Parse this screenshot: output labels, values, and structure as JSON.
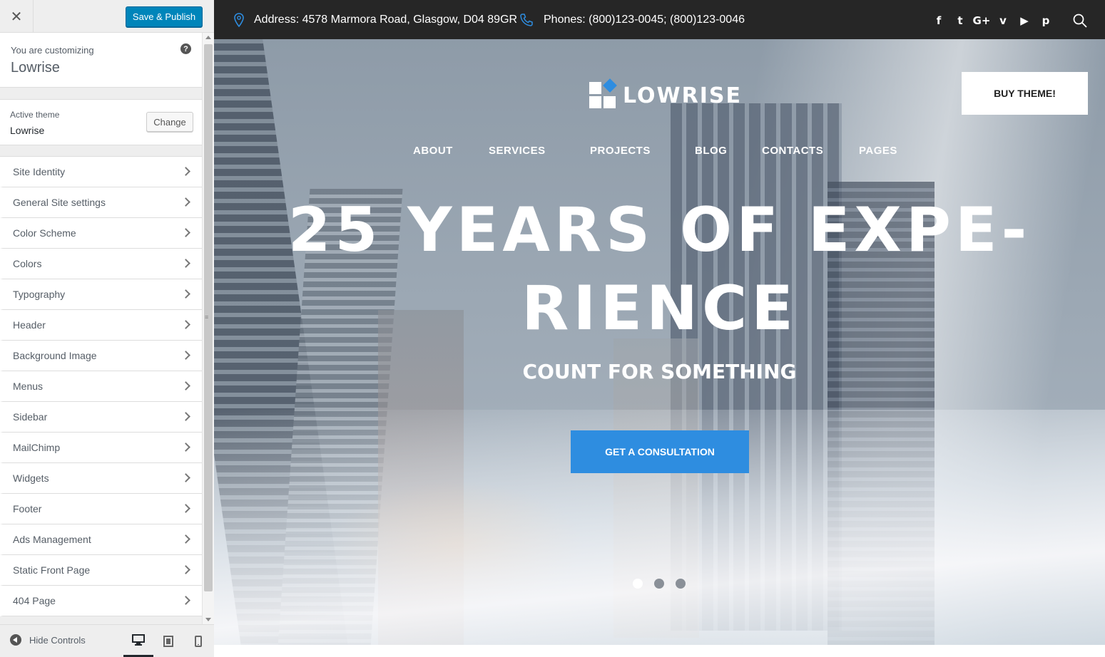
{
  "customizer": {
    "close_label": "✕",
    "publish_label": "Save & Publish",
    "info": {
      "label": "You are customizing",
      "title": "Lowrise",
      "help": "?"
    },
    "theme": {
      "label": "Active theme",
      "name": "Lowrise",
      "change_label": "Change"
    },
    "sections": [
      {
        "label": "Site Identity"
      },
      {
        "label": "General Site settings"
      },
      {
        "label": "Color Scheme"
      },
      {
        "label": "Colors"
      },
      {
        "label": "Typography"
      },
      {
        "label": "Header"
      },
      {
        "label": "Background Image"
      },
      {
        "label": "Menus"
      },
      {
        "label": "Sidebar"
      },
      {
        "label": "MailChimp"
      },
      {
        "label": "Widgets"
      },
      {
        "label": "Footer"
      },
      {
        "label": "Ads Management"
      },
      {
        "label": "Static Front Page"
      },
      {
        "label": "404 Page"
      }
    ],
    "footer": {
      "hide_label": "Hide Controls",
      "devices": [
        "desktop-icon",
        "tablet-icon",
        "mobile-icon"
      ],
      "active_device": "desktop"
    }
  },
  "site": {
    "topbar": {
      "address": "Address: 4578 Marmora Road, Glasgow, D04 89GR",
      "phones": "Phones: (800)123-0045; (800)123-0046",
      "socials": [
        {
          "icon": "facebook-icon",
          "glyph": "f"
        },
        {
          "icon": "twitter-icon",
          "glyph": "t"
        },
        {
          "icon": "google-plus-icon",
          "glyph": "G+"
        },
        {
          "icon": "vimeo-icon",
          "glyph": "v"
        },
        {
          "icon": "youtube-icon",
          "glyph": "▶"
        },
        {
          "icon": "pinterest-icon",
          "glyph": "p"
        }
      ]
    },
    "logo_text": "LOWRISE",
    "buy_label": "BUY THEME!",
    "nav": [
      {
        "label": "ABOUT"
      },
      {
        "label": "SERVICES"
      },
      {
        "label": "PROJECTS"
      },
      {
        "label": "BLOG"
      },
      {
        "label": "CONTACTS"
      },
      {
        "label": "PAGES"
      }
    ],
    "hero": {
      "headline_line1": "25 YEARS OF EXPE-",
      "headline_line2": "RIENCE",
      "subheadline": "COUNT FOR SOMETHING",
      "cta_label": "GET A CONSULTATION",
      "slides": 3,
      "active_slide": 1
    },
    "colors": {
      "accent": "#2e8de0",
      "topbar": "#262626",
      "wp_primary": "#0085ba"
    }
  }
}
